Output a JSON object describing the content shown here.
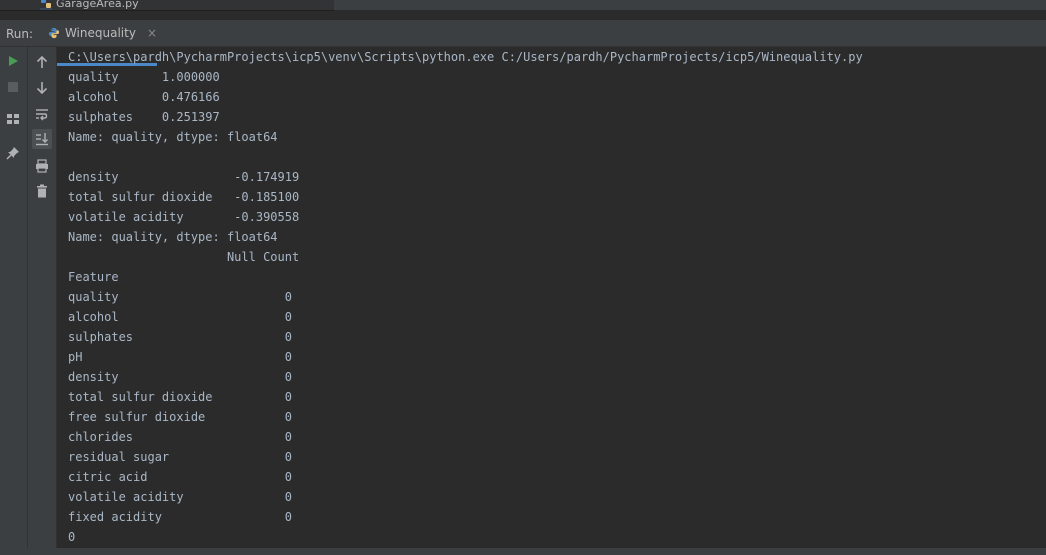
{
  "project_tree": {
    "file_name": "GarageArea.py"
  },
  "run_panel": {
    "label": "Run:",
    "tab_name": "Winequality",
    "close_glyph": "×"
  },
  "toolbar_icons": [
    "run-icon",
    "stop-icon",
    "layout-icon",
    "pin-icon",
    "scroll-up-icon",
    "scroll-down-icon",
    "soft-wrap-icon",
    "scroll-to-end-icon",
    "print-icon",
    "trash-icon"
  ],
  "colors": {
    "run_green": "#499c54",
    "accent_blue": "#4a88c7",
    "console_text": "#a9b7c6"
  },
  "console": {
    "lines": [
      "C:\\Users\\pardh\\PycharmProjects\\icp5\\venv\\Scripts\\python.exe C:/Users/pardh/PycharmProjects/icp5/Winequality.py",
      "quality      1.000000",
      "alcohol      0.476166",
      "sulphates    0.251397",
      "Name: quality, dtype: float64",
      "",
      "density                -0.174919",
      "total sulfur dioxide   -0.185100",
      "volatile acidity       -0.390558",
      "Name: quality, dtype: float64",
      "                      Null Count",
      "Feature",
      "quality                       0",
      "alcohol                       0",
      "sulphates                     0",
      "pH                            0",
      "density                       0",
      "total sulfur dioxide          0",
      "free sulfur dioxide           0",
      "chlorides                     0",
      "residual sugar                0",
      "citric acid                   0",
      "volatile acidity              0",
      "fixed acidity                 0",
      "0"
    ]
  }
}
